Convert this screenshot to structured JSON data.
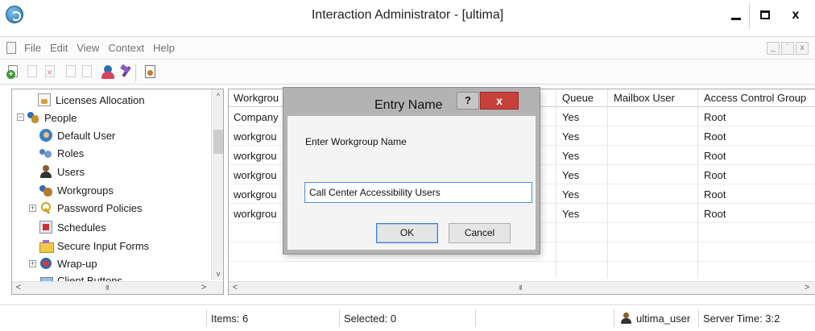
{
  "window": {
    "title": "Interaction Administrator - [ultima]",
    "minimize_label": "",
    "close_label": "x"
  },
  "menu": {
    "items": [
      "File",
      "Edit",
      "View",
      "Context",
      "Help"
    ],
    "mdi_buttons": [
      "_",
      "´",
      "x"
    ]
  },
  "toolbar": {
    "icons": [
      "new-icon",
      "edit-icon",
      "delete-icon",
      "copy-icon",
      "paste-icon",
      "people-icon",
      "pin-icon",
      "properties-icon"
    ]
  },
  "tree": {
    "items": [
      {
        "label": "Licenses Allocation",
        "icon": "license-icon"
      },
      {
        "label": "People",
        "icon": "people-icon",
        "expander": "−"
      },
      {
        "label": "Default User",
        "icon": "default-user-icon"
      },
      {
        "label": "Roles",
        "icon": "roles-icon"
      },
      {
        "label": "Users",
        "icon": "users-icon"
      },
      {
        "label": "Workgroups",
        "icon": "workgroups-icon"
      },
      {
        "label": "Password Policies",
        "icon": "password-icon",
        "expander": "+"
      },
      {
        "label": "Schedules",
        "icon": "schedules-icon"
      },
      {
        "label": "Secure Input Forms",
        "icon": "secure-forms-icon"
      },
      {
        "label": "Wrap-up",
        "icon": "wrapup-icon",
        "expander": "+"
      },
      {
        "label": "Client Buttons",
        "icon": "client-buttons-icon"
      }
    ],
    "scroll_grip": "III"
  },
  "grid": {
    "columns": [
      "Workgrou",
      "Queue",
      "Mailbox User",
      "Access Control Group"
    ],
    "rows": [
      {
        "name": "Company",
        "queue": "Yes",
        "mailbox": "",
        "acg": "Root"
      },
      {
        "name": "workgrou",
        "queue": "Yes",
        "mailbox": "",
        "acg": "Root"
      },
      {
        "name": "workgrou",
        "queue": "Yes",
        "mailbox": "",
        "acg": "Root"
      },
      {
        "name": "workgrou",
        "queue": "Yes",
        "mailbox": "",
        "acg": "Root"
      },
      {
        "name": "workgrou",
        "queue": "Yes",
        "mailbox": "",
        "acg": "Root"
      },
      {
        "name": "workgrou",
        "queue": "Yes",
        "mailbox": "",
        "acg": "Root"
      }
    ],
    "scroll_grip": "III"
  },
  "status": {
    "items": "Items: 6",
    "selected": "Selected: 0",
    "user": "ultima_user",
    "server_time": "Server Time: 3:2"
  },
  "dialog": {
    "title": "Entry Name",
    "help_label": "?",
    "close_label": "x",
    "prompt": "Enter Workgroup Name",
    "input_value": "Call Center Accessibility Users",
    "ok_label": "OK",
    "cancel_label": "Cancel"
  }
}
